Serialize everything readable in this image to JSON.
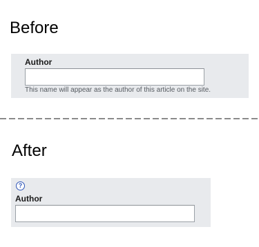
{
  "before": {
    "heading": "Before",
    "field_label": "Author",
    "input_value": "",
    "help_text": "This name will appear as the author of this article on the site."
  },
  "after": {
    "heading": "After",
    "help_icon_glyph": "?",
    "help_icon": "help-circle-icon",
    "field_label": "Author",
    "input_value": ""
  },
  "colors": {
    "panel_background": "#e8eaed",
    "help_icon_accent": "#2f56b8",
    "divider": "#8a8a8a"
  }
}
